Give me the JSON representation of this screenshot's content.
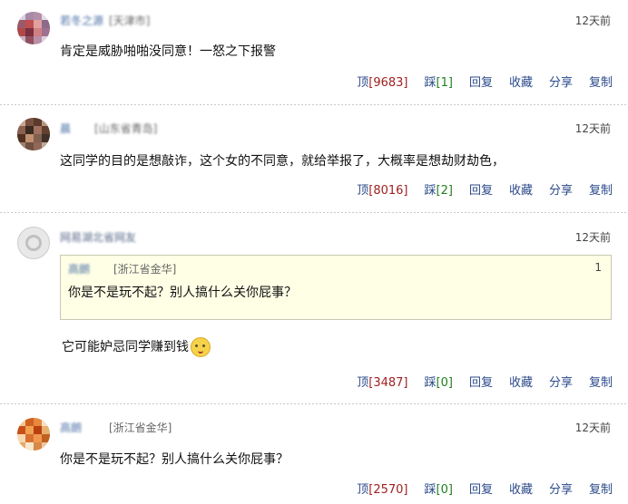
{
  "comments": [
    {
      "username": "若冬之源",
      "location": "[天津市]",
      "time": "12天前",
      "text": "肯定是威胁啪啪没同意！一怒之下报警",
      "actions": {
        "up_label": "顶",
        "up_count": "[9683]",
        "down_label": "踩",
        "down_count": "[1]",
        "reply": "回复",
        "collect": "收藏",
        "share": "分享",
        "copy": "复制"
      }
    },
    {
      "username": "晨",
      "location": "[山东省青岛]",
      "time": "12天前",
      "text": "这同学的目的是想敲诈，这个女的不同意，就给举报了，大概率是想劫财劫色，",
      "actions": {
        "up_label": "顶",
        "up_count": "[8016]",
        "down_label": "踩",
        "down_count": "[2]",
        "reply": "回复",
        "collect": "收藏",
        "share": "分享",
        "copy": "复制"
      }
    },
    {
      "username": "网易湖北省网友",
      "location": "",
      "time": "12天前",
      "quote": {
        "username": "高朗",
        "location": "[浙江省金华]",
        "floor": "1",
        "text": "你是不是玩不起？别人搞什么关你屁事？"
      },
      "text": "它可能妒忌同学赚到钱",
      "emoji": "cat-smile-icon",
      "actions": {
        "up_label": "顶",
        "up_count": "[3487]",
        "down_label": "踩",
        "down_count": "[0]",
        "reply": "回复",
        "collect": "收藏",
        "share": "分享",
        "copy": "复制"
      }
    },
    {
      "username": "高朗",
      "location": "[浙江省金华]",
      "time": "12天前",
      "text": "你是不是玩不起？别人搞什么关你屁事？",
      "actions": {
        "up_label": "顶",
        "up_count": "[2570]",
        "down_label": "踩",
        "down_count": "[0]",
        "reply": "回复",
        "collect": "收藏",
        "share": "分享",
        "copy": "复制"
      }
    }
  ]
}
